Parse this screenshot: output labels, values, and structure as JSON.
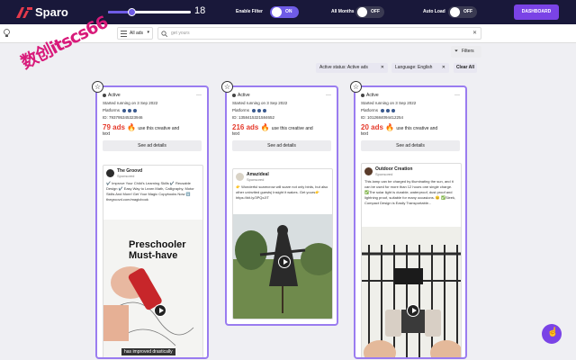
{
  "app": {
    "name": "Sparo"
  },
  "topbar": {
    "slider_value": "18",
    "slider_fraction": 0.28,
    "enable_filter": {
      "label": "Enable Filter",
      "state": "ON"
    },
    "all_months": {
      "label": "All Months",
      "state": "OFF"
    },
    "auto_load": {
      "label": "Auto Load",
      "state": "OFF"
    },
    "dashboard_label": "DASHBOARD"
  },
  "search": {
    "ad_type": "All ads",
    "placeholder": "get yours"
  },
  "filters": {
    "button_label": "Filters",
    "chips": [
      {
        "label": "Active status: Active ads"
      },
      {
        "label": "Language: English"
      }
    ],
    "clear_all": "Clear All"
  },
  "watermark": "数创itscs66",
  "cards": [
    {
      "status": "Active",
      "started": "Started running on 3 Sep 2022",
      "platforms": "Platforms",
      "id": "ID: 793795345323946",
      "ads_count": "79 ads",
      "ads_text": "use this creative and",
      "ads_text2": "text",
      "see_details": "See ad details",
      "advertiser": "The Groovd",
      "sponsored": "Sponsored",
      "body": "✔️ Improve Your Child's Learning Skills ✔️ Reusable Design ✔️ Easy Way to Learn Math, Calligraphy, Motor Skills And More! Get Your Magic Copybooks Now ⬇️ thegroovd.com/magicbook",
      "overlay": "Preschooler Must-have",
      "caption": "has improved drastically"
    },
    {
      "status": "Active",
      "started": "Started running on 3 Sep 2022",
      "platforms": "Platforms",
      "id": "ID: 1358415321584652",
      "ads_count": "216 ads",
      "ads_text": "use this creative and",
      "ads_text2": "text",
      "see_details": "See ad details",
      "advertiser": "Amazideal",
      "sponsored": "Sponsored",
      "body": "👉 Wonderful scarecrow will scare not only birds, but also other uninvited guests| Insight it wakes. Get yours👉 https://bit.ly/3PQxJIT"
    },
    {
      "status": "Active",
      "started": "Started running on 3 Sep 2022",
      "platforms": "Platforms",
      "id": "ID: 1012684094412254",
      "ads_count": "20 ads",
      "ads_text": "use this creative and",
      "ads_text2": "text",
      "see_details": "See ad details",
      "advertiser": "Outdoor Creation",
      "sponsored": "Sponsored",
      "body": "This lamp can be charged by illuminating the sun, and it can be used for more than 12 hours one single charge. ✅The solar light is durable, waterproof, dust proof and lightning proof, suitable for many occasions. 😊 ✅Sleek, Compact Design is Easily Transportable..."
    }
  ]
}
